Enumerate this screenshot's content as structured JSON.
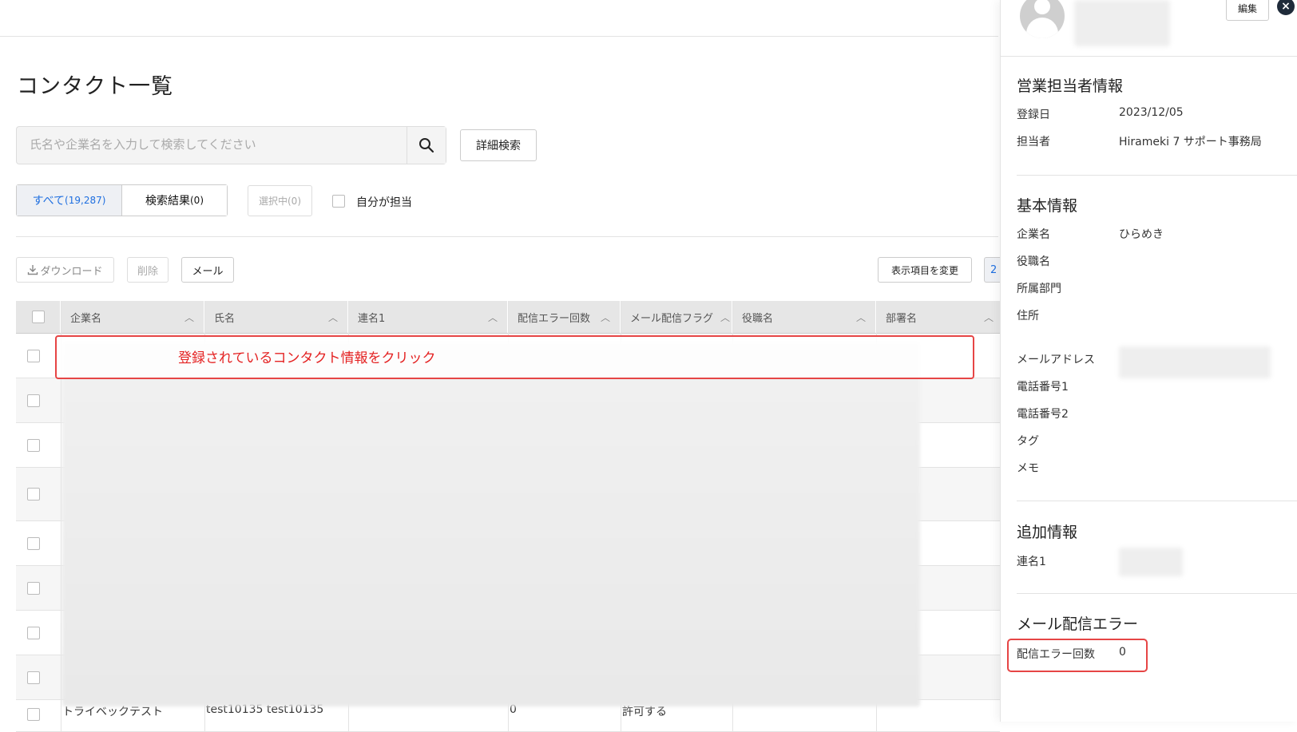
{
  "page": {
    "title": "コンタクト一覧"
  },
  "search": {
    "placeholder": "氏名や企業名を入力して検索してください",
    "advanced_label": "詳細検索"
  },
  "tabs": [
    {
      "label": "すべて",
      "count": "(19,287)"
    },
    {
      "label": "検索結果",
      "count": "(0)"
    }
  ],
  "selected_label": "選択中(0)",
  "mine_label": "自分が担当",
  "toolbar": {
    "download": "ダウンロード",
    "delete": "削除",
    "mail": "メール",
    "change_columns": "表示項目を変更",
    "pager_partial": "2"
  },
  "table": {
    "columns": [
      "企業名",
      "氏名",
      "連名1",
      "配信エラー回数",
      "メール配信フラグ",
      "役職名",
      "部署名"
    ],
    "partial_last_row": [
      "トライベックテスト",
      "test10135 test10135",
      "",
      "0",
      "許可する",
      "",
      ""
    ]
  },
  "annotation": {
    "text": "登録されているコンタクト情報をクリック",
    "color": "#e42222"
  },
  "panel": {
    "edit_label": "編集",
    "close_icon": "×",
    "sales": {
      "title": "営業担当者情報",
      "rows": [
        {
          "label": "登録日",
          "value": "2023/12/05"
        },
        {
          "label": "担当者",
          "value": "Hirameki 7 サポート事務局"
        }
      ]
    },
    "basic": {
      "title": "基本情報",
      "rows": [
        {
          "label": "企業名",
          "value": "ひらめき"
        },
        {
          "label": "役職名",
          "value": ""
        },
        {
          "label": "所属部門",
          "value": ""
        },
        {
          "label": "住所",
          "value": ""
        },
        {
          "label": "メールアドレス",
          "value": ""
        },
        {
          "label": "電話番号1",
          "value": ""
        },
        {
          "label": "電話番号2",
          "value": ""
        },
        {
          "label": "タグ",
          "value": ""
        },
        {
          "label": "メモ",
          "value": ""
        }
      ]
    },
    "extra": {
      "title": "追加情報",
      "rows": [
        {
          "label": "連名1",
          "value": ""
        }
      ]
    },
    "mail_error": {
      "title": "メール配信エラー",
      "rows": [
        {
          "label": "配信エラー回数",
          "value": "0"
        }
      ]
    }
  },
  "colors": {
    "accent": "#1f6fe0",
    "annotation": "#e64545"
  }
}
